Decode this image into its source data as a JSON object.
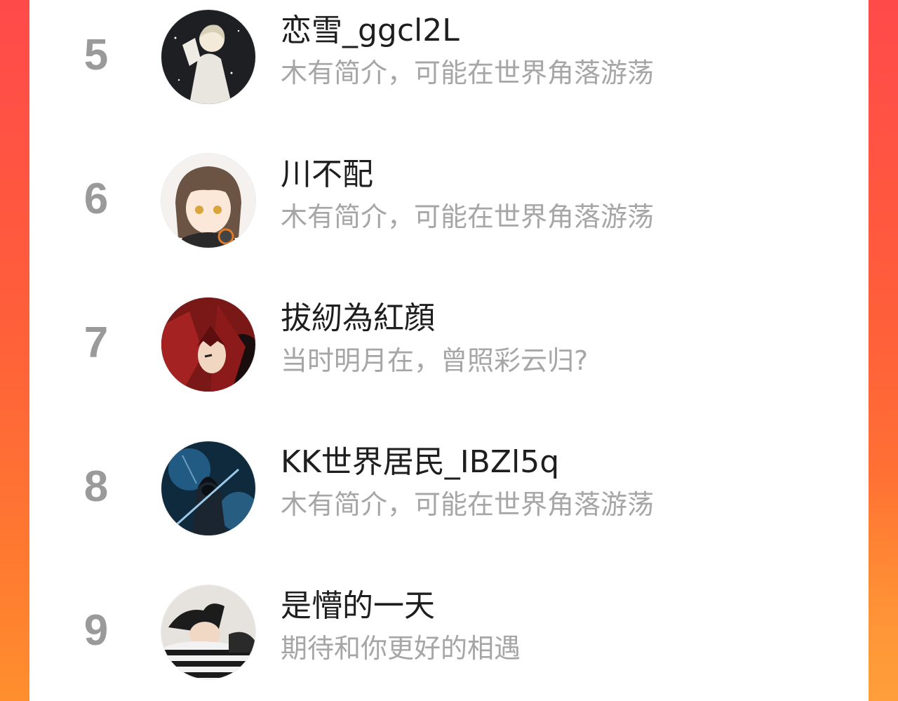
{
  "colors": {
    "background_left": "#ff4a4a",
    "background_right": "#ff7a30",
    "panel": "#ffffff",
    "rank_text": "#9a9a9a",
    "name_text": "#1e1e1e",
    "bio_text": "#a6a6a6"
  },
  "ranking": [
    {
      "rank": "5",
      "name": "恋雪_ggcl2L",
      "bio": "木有简介，可能在世界角落游荡",
      "avatar_icon": "avatar-white-hair-boy-icon"
    },
    {
      "rank": "6",
      "name": "川不配",
      "bio": "木有简介，可能在世界角落游荡",
      "avatar_icon": "avatar-anime-girl-headphones-icon"
    },
    {
      "rank": "7",
      "name": "拔紉為紅顔",
      "bio": "当时明月在，曾照彩云归?",
      "avatar_icon": "avatar-red-hair-anime-icon"
    },
    {
      "rank": "8",
      "name": "KK世界居民_IBZl5q",
      "bio": "木有简介，可能在世界角落游荡",
      "avatar_icon": "avatar-hooded-warrior-icon"
    },
    {
      "rank": "9",
      "name": "是懵的一天",
      "bio": "期待和你更好的相遇",
      "avatar_icon": "avatar-sleeping-person-icon"
    }
  ]
}
